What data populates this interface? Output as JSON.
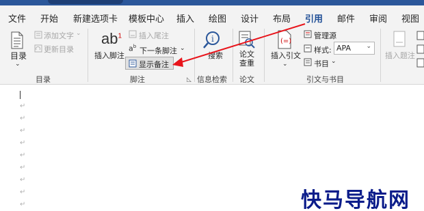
{
  "tabs": [
    {
      "label": "文件"
    },
    {
      "label": "开始"
    },
    {
      "label": "新建选项卡"
    },
    {
      "label": "模板中心"
    },
    {
      "label": "插入"
    },
    {
      "label": "绘图"
    },
    {
      "label": "设计"
    },
    {
      "label": "布局"
    },
    {
      "label": "引用"
    },
    {
      "label": "邮件"
    },
    {
      "label": "审阅"
    },
    {
      "label": "视图"
    }
  ],
  "ribbon": {
    "toc": {
      "label": "目录",
      "add_text": "添加文字",
      "update_toc": "更新目录",
      "group": "目录"
    },
    "footnotes": {
      "insert_footnote": "插入脚注",
      "insert_endnote": "插入尾注",
      "next_footnote": "下一条脚注",
      "show_notes": "显示备注",
      "group": "脚注"
    },
    "research": {
      "search": "搜索",
      "group": "信息检索"
    },
    "paper": {
      "paper_lookup": "论文查重",
      "group": "论文"
    },
    "citations": {
      "insert_citation": "插入引文",
      "manage_sources": "管理源",
      "style_label": "样式:",
      "style_value": "APA",
      "bibliography": "书目",
      "group": "引文与书目"
    },
    "captions": {
      "insert_caption": "插入题注"
    }
  },
  "document": {
    "paragraph_mark": "↵"
  },
  "watermark": "快马导航网",
  "colors": {
    "accent": "#1f4e96",
    "arrow": "#e8141b",
    "ribbon_bg": "#f3f3f3"
  }
}
